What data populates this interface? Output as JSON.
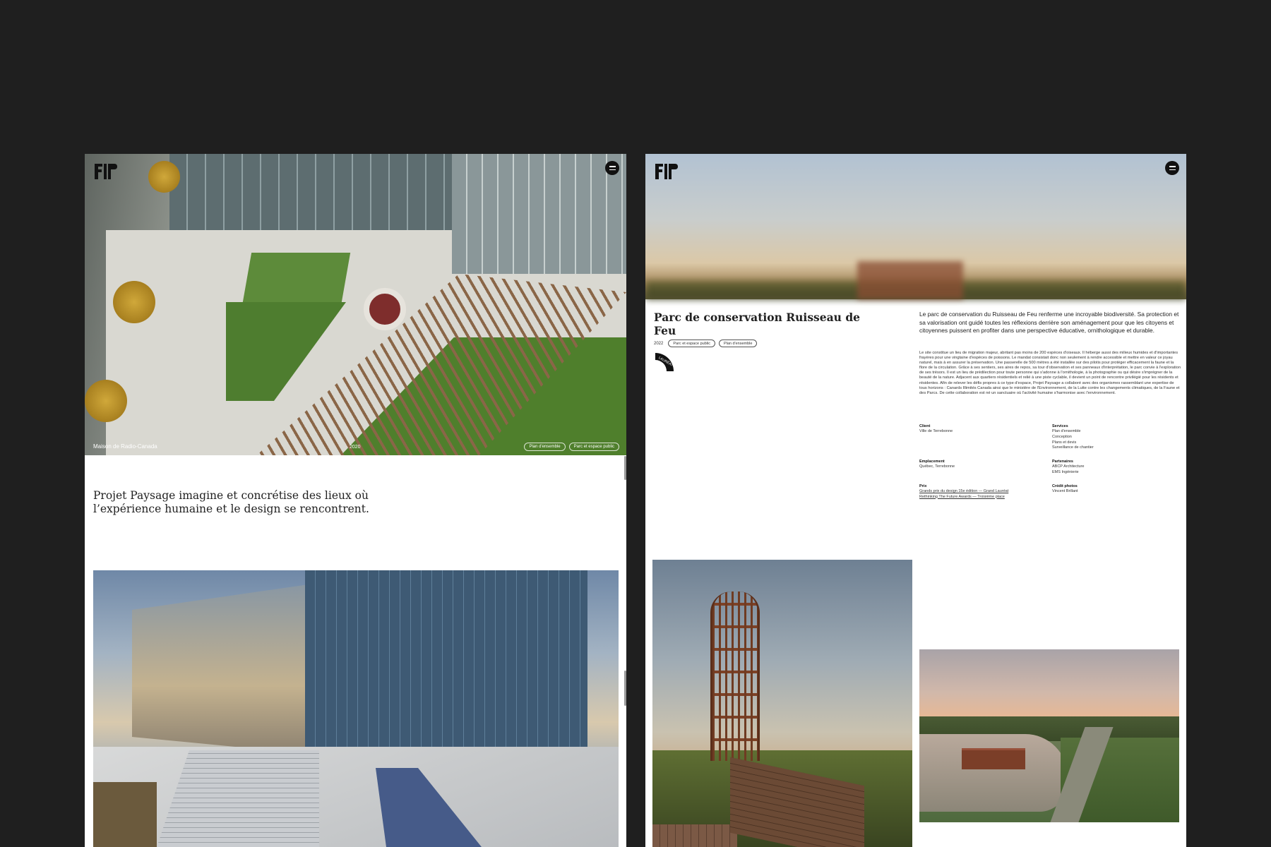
{
  "left_panel": {
    "hero": {
      "caption": "Maison de Radio-Canada",
      "year": "2020",
      "tags": [
        "Plan d'ensemble",
        "Parc et espace public"
      ]
    },
    "tagline": "Projet Paysage imagine et concrétise des lieux où l’expérience humaine et le design se rencontrent."
  },
  "right_panel": {
    "project": {
      "title": "Parc de conservation Ruisseau de Feu",
      "year": "2022",
      "tags": [
        "Parc et espace public",
        "Plan d'ensemble"
      ],
      "badge": "LAURÉAT"
    },
    "lead": "Le parc de conservation du Ruisseau de Feu renferme une incroyable biodiversité. Sa protection et sa valorisation ont guidé toutes les réflexions derrière son aménagement pour que les citoyens et citoyennes puissent en profiter dans une perspective éducative, ornithologique et durable.",
    "body": "Le site constitue un lieu de migration majeur, abritant pas moins de 200 espèces d'oiseaux. Il héberge aussi des milieux humides et d'importantes frayères pour une vingtaine d'espèces de poissons. Le mandat consistait donc non seulement à rendre accessible et mettre en valeur ce joyau naturel, mais à en assurer la préservation. Une passerelle de 500 mètres a été installée sur des pilotis pour protéger efficacement la faune et la flore de la circulation. Grâce à ses sentiers, ses aires de repos, sa tour d'observation et ses panneaux d'interprétation, le parc convie à l'exploration de ses trésors. Il est un lieu de prédilection pour toute personne qui s'adonne à l'ornithologie, à la photographie ou qui désire s'imprégner de la beauté de la nature. Adjacent aux quartiers résidentiels et relié à une piste cyclable, il devient un point de rencontre privilégié pour les résidents et résidentes. Afin de relever les défis propres à ce type d'espace, Projet Paysage a collaboré avec des organismes rassemblant une expertise de tous horizons : Canards Illimités Canada ainsi que le ministère de l'Environnement, de la Lutte contre les changements climatiques, de la Faune et des Parcs. De cette collaboration est né un sanctuaire où l'activité humaine s'harmonise avec l'environnement.",
    "info": {
      "client_label": "Client",
      "client": [
        "Ville de Terrebonne"
      ],
      "services_label": "Services",
      "services": [
        "Plan d'ensemble",
        "Conception",
        "Plans et devis",
        "Surveillance de chantier"
      ],
      "location_label": "Emplacement",
      "location": [
        "Québec, Terrebonne"
      ],
      "partners_label": "Partenaires",
      "partners": [
        "ABCP Architecture",
        "EMS Ingénierie"
      ],
      "awards_label": "Prix",
      "awards": [
        "Grands prix du design 15e édition — Grand Lauréat",
        "Rethinking The Future Awards — Troisième place"
      ],
      "photo_credit_label": "Crédit photos",
      "photo_credit": [
        "Vincent Brillant"
      ]
    }
  },
  "colors": {
    "background": "#1f1f1f",
    "panel": "#ffffff",
    "text": "#1a1a1a"
  },
  "icons": {
    "logo": "projet-paysage-logo",
    "menu": "hamburger-menu-icon"
  }
}
